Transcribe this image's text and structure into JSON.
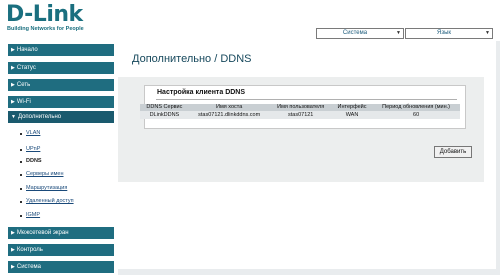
{
  "brand": {
    "name": "D-Link",
    "tagline": "Building Networks for People"
  },
  "top_menu": {
    "system": "Система",
    "language": "Язык",
    "arrow": "▼"
  },
  "sidebar": {
    "items": [
      {
        "label": "Начало"
      },
      {
        "label": "Статус"
      },
      {
        "label": "Сеть"
      },
      {
        "label": "Wi-Fi"
      },
      {
        "label": "Дополнительно"
      }
    ],
    "subitems": [
      {
        "label": "VLAN"
      },
      {
        "label": "UPnP"
      },
      {
        "label": "DDNS"
      },
      {
        "label": "Серверы имен"
      },
      {
        "label": "Маршрутизация"
      },
      {
        "label": "Удаленный доступ"
      },
      {
        "label": "IGMP"
      }
    ],
    "bottom_items": [
      {
        "label": "Межсетевой экран"
      },
      {
        "label": "Контроль"
      },
      {
        "label": "Система"
      }
    ]
  },
  "page": {
    "title": "Дополнительно  /  DDNS"
  },
  "ddns": {
    "box_title": "Настройка клиента DDNS",
    "headers": [
      "DDNS Сервис",
      "Имя хоста",
      "Имя пользователя",
      "Интерфейс",
      "Период обновления (мин.)"
    ],
    "row": [
      "DLinkDDNS",
      "stas07121.dlinkddns.com",
      "stas07121",
      "WAN",
      "60"
    ],
    "add_label": "Добавить"
  },
  "colors": {
    "accent": "#1f6d80",
    "brand": "#1a6f7f"
  }
}
